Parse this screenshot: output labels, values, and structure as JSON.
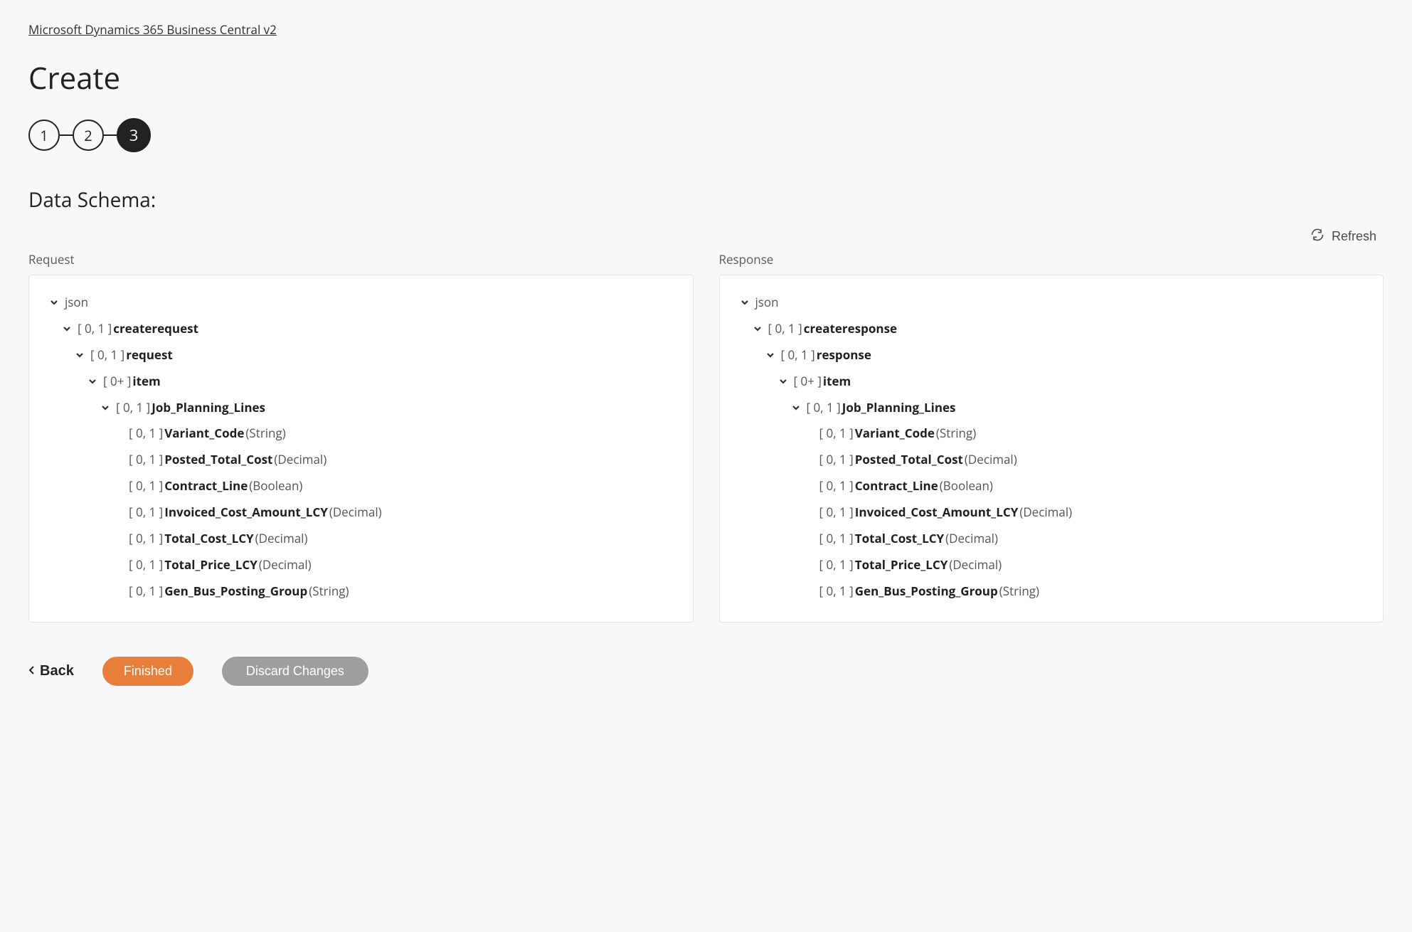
{
  "breadcrumb": {
    "label": "Microsoft Dynamics 365 Business Central v2"
  },
  "page": {
    "title": "Create"
  },
  "stepper": {
    "steps": [
      {
        "number": "1",
        "active": false
      },
      {
        "number": "2",
        "active": false
      },
      {
        "number": "3",
        "active": true
      }
    ]
  },
  "section": {
    "label": "Data Schema:"
  },
  "refresh": {
    "label": "Refresh"
  },
  "columns": {
    "request": {
      "label": "Request",
      "tree": {
        "root": {
          "label": "json"
        },
        "l1": {
          "card": "[ 0, 1 ]",
          "name": "createrequest"
        },
        "l2": {
          "card": "[ 0, 1 ]",
          "name": "request"
        },
        "l3": {
          "card": "[ 0+ ]",
          "name": "item"
        },
        "l4": {
          "card": "[ 0, 1 ]",
          "name": "Job_Planning_Lines"
        },
        "fields": [
          {
            "card": "[ 0, 1 ]",
            "name": "Variant_Code",
            "type": "(String)"
          },
          {
            "card": "[ 0, 1 ]",
            "name": "Posted_Total_Cost",
            "type": "(Decimal)"
          },
          {
            "card": "[ 0, 1 ]",
            "name": "Contract_Line",
            "type": "(Boolean)"
          },
          {
            "card": "[ 0, 1 ]",
            "name": "Invoiced_Cost_Amount_LCY",
            "type": "(Decimal)"
          },
          {
            "card": "[ 0, 1 ]",
            "name": "Total_Cost_LCY",
            "type": "(Decimal)"
          },
          {
            "card": "[ 0, 1 ]",
            "name": "Total_Price_LCY",
            "type": "(Decimal)"
          },
          {
            "card": "[ 0, 1 ]",
            "name": "Gen_Bus_Posting_Group",
            "type": "(String)"
          }
        ]
      }
    },
    "response": {
      "label": "Response",
      "tree": {
        "root": {
          "label": "json"
        },
        "l1": {
          "card": "[ 0, 1 ]",
          "name": "createresponse"
        },
        "l2": {
          "card": "[ 0, 1 ]",
          "name": "response"
        },
        "l3": {
          "card": "[ 0+ ]",
          "name": "item"
        },
        "l4": {
          "card": "[ 0, 1 ]",
          "name": "Job_Planning_Lines"
        },
        "fields": [
          {
            "card": "[ 0, 1 ]",
            "name": "Variant_Code",
            "type": "(String)"
          },
          {
            "card": "[ 0, 1 ]",
            "name": "Posted_Total_Cost",
            "type": "(Decimal)"
          },
          {
            "card": "[ 0, 1 ]",
            "name": "Contract_Line",
            "type": "(Boolean)"
          },
          {
            "card": "[ 0, 1 ]",
            "name": "Invoiced_Cost_Amount_LCY",
            "type": "(Decimal)"
          },
          {
            "card": "[ 0, 1 ]",
            "name": "Total_Cost_LCY",
            "type": "(Decimal)"
          },
          {
            "card": "[ 0, 1 ]",
            "name": "Total_Price_LCY",
            "type": "(Decimal)"
          },
          {
            "card": "[ 0, 1 ]",
            "name": "Gen_Bus_Posting_Group",
            "type": "(String)"
          }
        ]
      }
    }
  },
  "footer": {
    "back": "Back",
    "finished": "Finished",
    "discard": "Discard Changes"
  }
}
